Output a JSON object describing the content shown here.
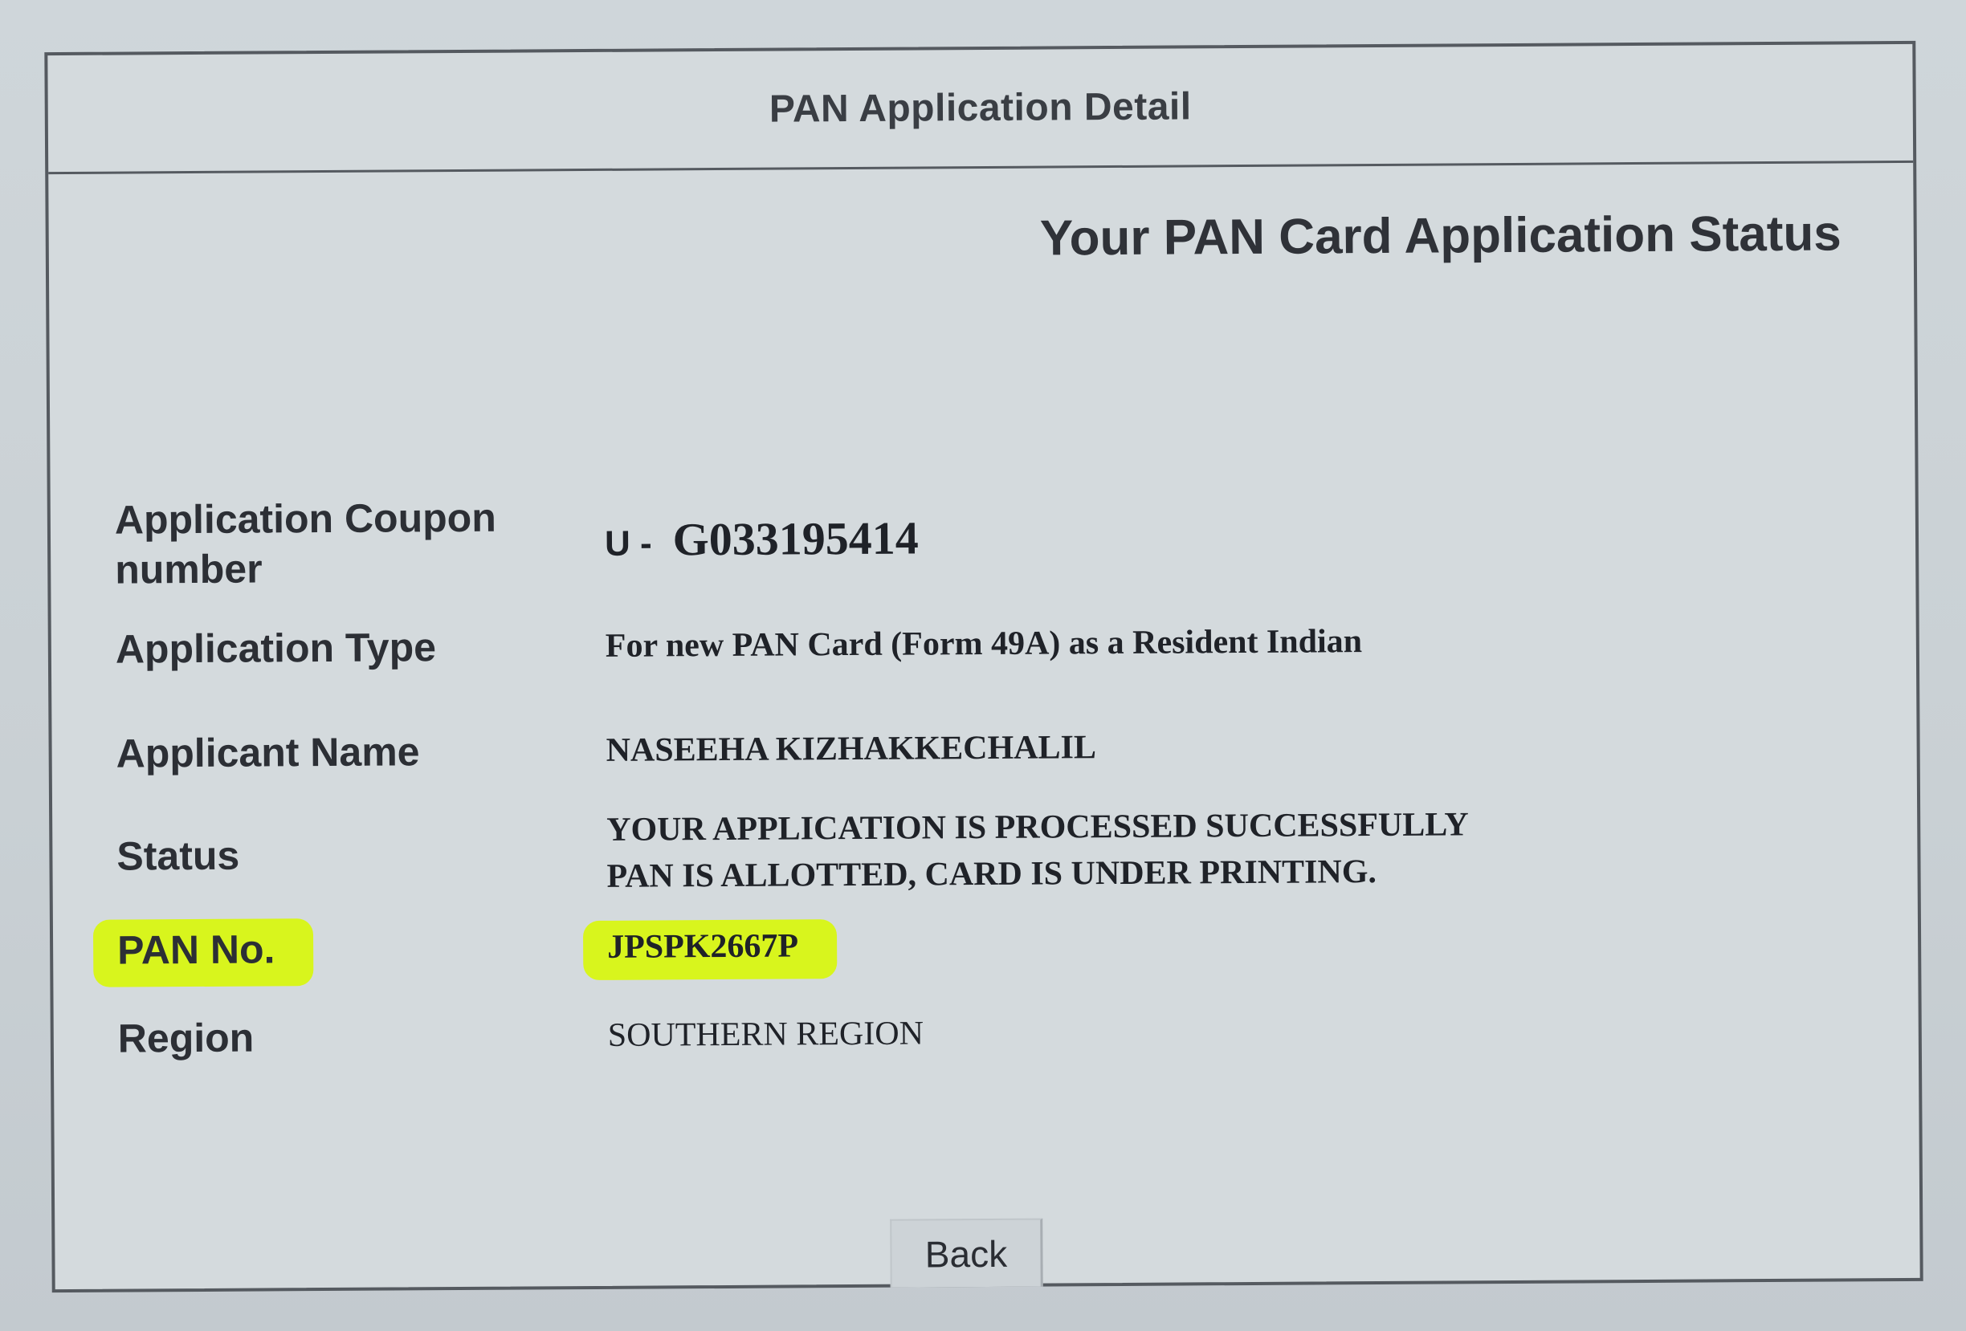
{
  "header": {
    "title": "PAN Application Detail"
  },
  "main": {
    "subtitle": "Your PAN Card Application Status",
    "fields": {
      "coupon": {
        "label": "Application Coupon number",
        "prefix": "U -",
        "value": "G033195414"
      },
      "type": {
        "label": "Application Type",
        "value": "For new PAN Card (Form 49A) as a Resident Indian"
      },
      "name": {
        "label": "Applicant Name",
        "value": "NASEEHA KIZHAKKECHALIL"
      },
      "status": {
        "label": "Status",
        "line1": "YOUR APPLICATION IS PROCESSED SUCCESSFULLY",
        "line2": "PAN IS ALLOTTED, CARD IS UNDER PRINTING."
      },
      "pan": {
        "label": "PAN No.",
        "value": "JPSPK2667P"
      },
      "region": {
        "label": "Region",
        "value": "SOUTHERN REGION"
      }
    }
  },
  "footer": {
    "back_label": "Back"
  },
  "colors": {
    "highlight": "#d8f51d",
    "background": "#ced4d8",
    "border": "#555a60"
  }
}
